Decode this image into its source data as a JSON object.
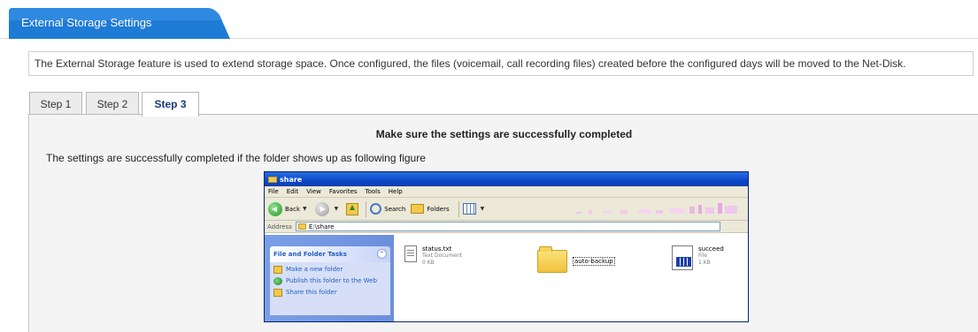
{
  "header": {
    "title": "External Storage Settings",
    "tab_color": "#1e7bd6"
  },
  "description": "The External Storage feature is used to extend storage space. Once configured, the files (voicemail, call recording files) created before the configured days will be moved to the Net-Disk.",
  "steps": {
    "step1": "Step 1",
    "step2": "Step 2",
    "step3": "Step 3",
    "active": "Step 3"
  },
  "panel": {
    "title": "Make sure the settings are successfully completed",
    "text": "The settings are successfully completed if the folder shows up as following figure"
  },
  "explorer": {
    "window_title": "share",
    "menu": [
      "File",
      "Edit",
      "View",
      "Favorites",
      "Tools",
      "Help"
    ],
    "toolbar": {
      "back": "Back",
      "search": "Search",
      "folders": "Folders"
    },
    "address_label": "Address",
    "address_value": "E:\\share",
    "tasks": {
      "heading": "File and Folder Tasks",
      "items": [
        "Make a new folder",
        "Publish this folder to the Web",
        "Share this folder"
      ]
    },
    "files": [
      {
        "name": "status.txt",
        "type": "Text Document",
        "size": "0 KB",
        "icon": "text-document-icon"
      },
      {
        "name": "auto-backup",
        "type": "",
        "size": "",
        "icon": "folder-icon"
      },
      {
        "name": "succeed",
        "type": "File",
        "size": "1 KB",
        "icon": "system-file-icon"
      }
    ]
  }
}
